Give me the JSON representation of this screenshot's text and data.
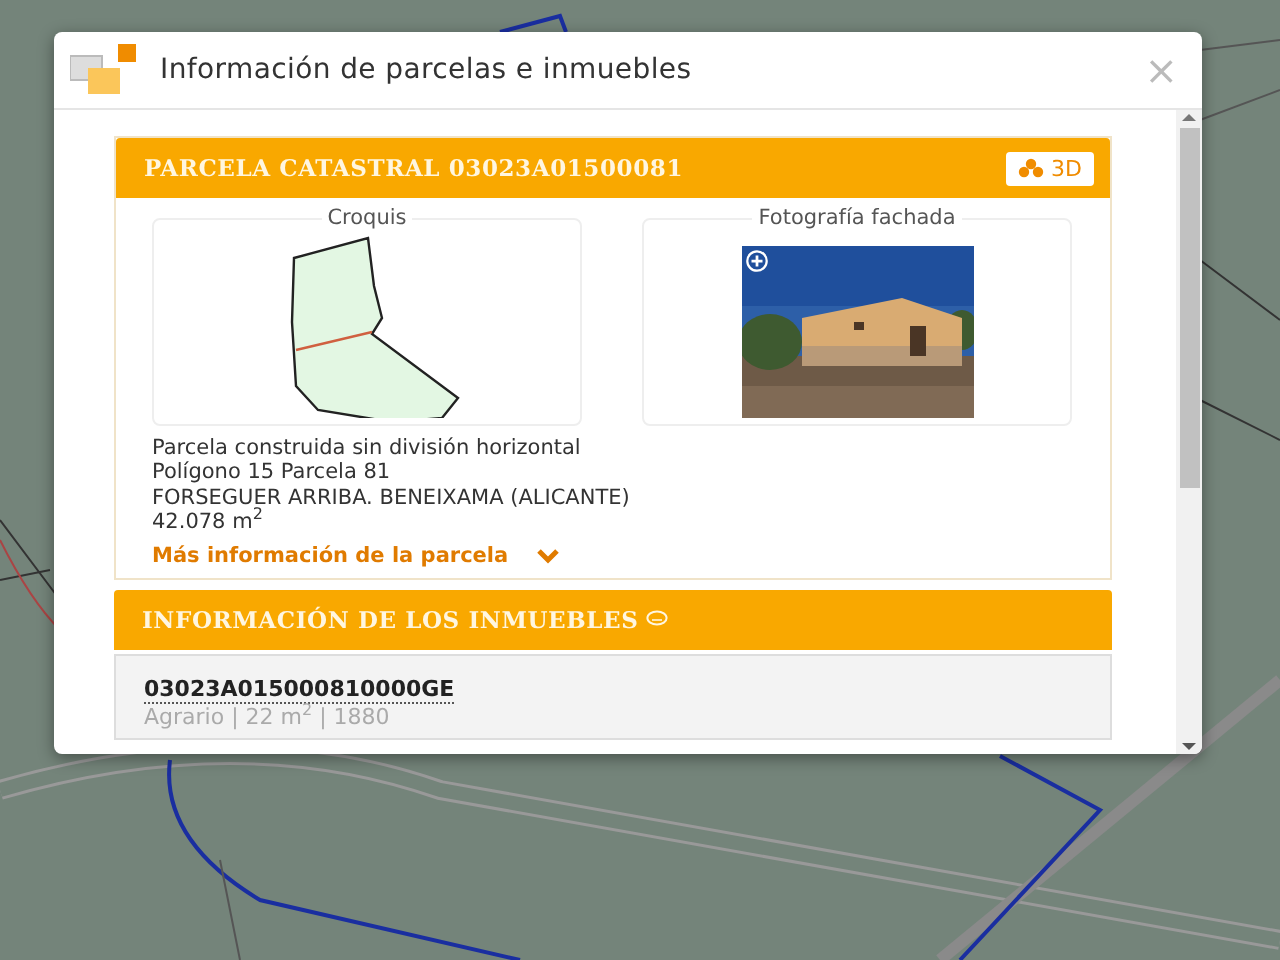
{
  "dialog": {
    "title": "Información de parcelas e inmuebles",
    "close": "×"
  },
  "parcel": {
    "title": "PARCELA CATASTRAL 03023A01500081",
    "button_3d": "3D",
    "sketch_label": "Croquis",
    "photo_label": "Fotografía fachada",
    "details": [
      "Parcela construida sin división horizontal",
      "Polígono 15 Parcela 81",
      "FORSEGUER ARRIBA. BENEIXAMA (ALICANTE)",
      "42.078 m$^{2}$"
    ],
    "more_link": "Más información de la parcela"
  },
  "properties": {
    "title": "INFORMACIÓN DE LOS INMUEBLES",
    "items": [
      {
        "reference": "03023A015000810000GE",
        "summary": "Agrario | 22 m$^{2}$ | 1880"
      }
    ]
  }
}
